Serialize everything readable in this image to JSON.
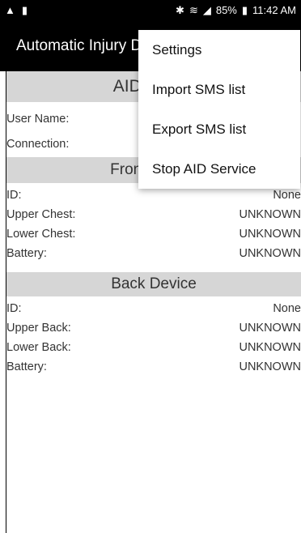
{
  "status_bar": {
    "alert_icon": "warning-icon",
    "notification_icon": "sim-icon",
    "right_text": "85%",
    "time": "11:42 AM"
  },
  "app_bar": {
    "title": "Automatic Injury Detection"
  },
  "main": {
    "aid_header": "AID Status",
    "user_name_label": "User Name:",
    "connection_label": "Connection:",
    "front_header": "Front Device",
    "front_rows": [
      {
        "label": "ID:",
        "value": "None"
      },
      {
        "label": "Upper Chest:",
        "value": "UNKNOWN"
      },
      {
        "label": "Lower Chest:",
        "value": "UNKNOWN"
      },
      {
        "label": "Battery:",
        "value": "UNKNOWN"
      }
    ],
    "back_header": "Back Device",
    "back_rows": [
      {
        "label": "ID:",
        "value": "None"
      },
      {
        "label": "Upper Back:",
        "value": "UNKNOWN"
      },
      {
        "label": "Lower Back:",
        "value": "UNKNOWN"
      },
      {
        "label": "Battery:",
        "value": "UNKNOWN"
      }
    ]
  },
  "overflow_menu": {
    "items": [
      "Settings",
      "Import SMS list",
      "Export SMS list",
      "Stop AID Service"
    ]
  }
}
